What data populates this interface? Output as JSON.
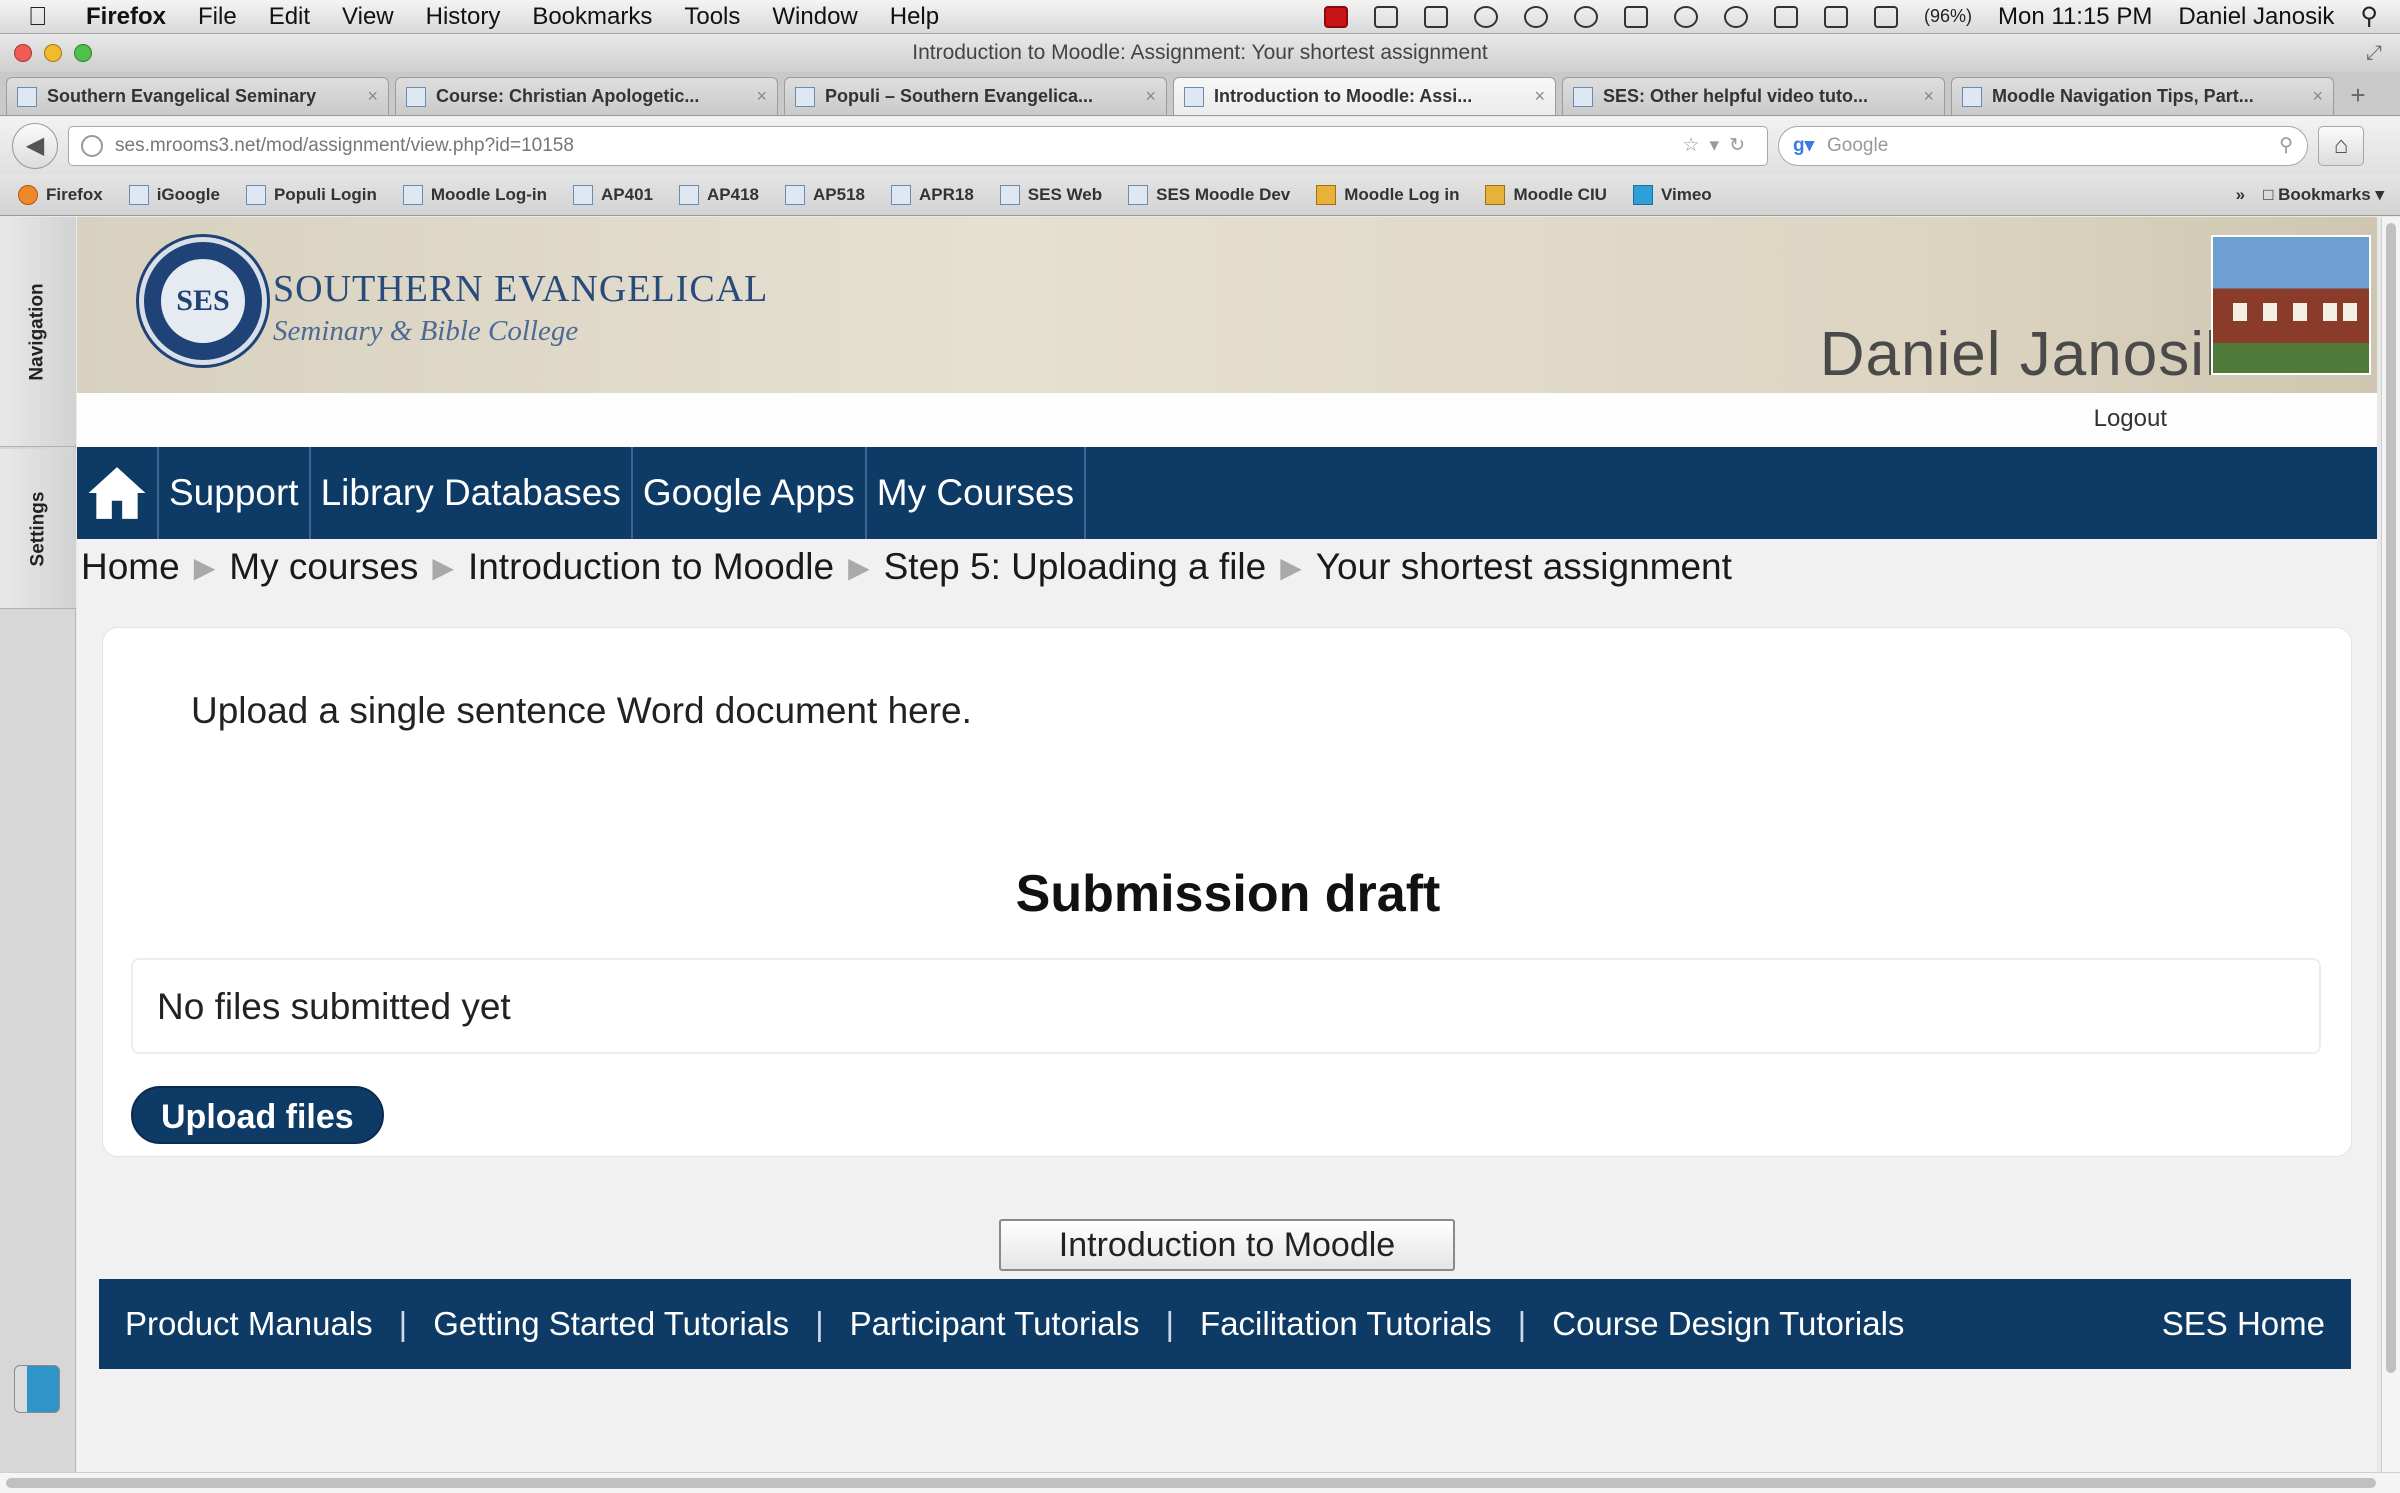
{
  "menubar": {
    "app": "Firefox",
    "items": [
      "File",
      "Edit",
      "View",
      "History",
      "Bookmarks",
      "Tools",
      "Window",
      "Help"
    ],
    "battery": "(96%)",
    "clock": "Mon 11:15 PM",
    "user": "Daniel Janosik"
  },
  "window": {
    "title": "Introduction to Moodle: Assignment: Your shortest assignment"
  },
  "tabs": [
    {
      "label": "Southern Evangelical Seminary"
    },
    {
      "label": "Course: Christian Apologetic..."
    },
    {
      "label": "Populi – Southern Evangelica..."
    },
    {
      "label": "Introduction to Moodle: Assi..."
    },
    {
      "label": "SES: Other helpful video tuto..."
    },
    {
      "label": "Moodle Navigation Tips, Part..."
    }
  ],
  "navbar": {
    "url": "ses.mrooms3.net/mod/assignment/view.php?id=10158",
    "search_placeholder": "Google"
  },
  "bookmarks": {
    "items": [
      "Firefox",
      "iGoogle",
      "Populi Login",
      "Moodle Log-in",
      "AP401",
      "AP418",
      "AP518",
      "APR18",
      "SES Web",
      "SES Moodle Dev",
      "Moodle Log in",
      "Moodle CIU",
      "Vimeo"
    ],
    "overflow": "»",
    "bookmarks_menu": "Bookmarks"
  },
  "sidebar": {
    "navigation": "Navigation",
    "settings": "Settings"
  },
  "banner": {
    "school_line1": "SOUTHERN EVANGELICAL",
    "school_line2": "Seminary & Bible College",
    "seal_text": "SES",
    "user_display": "Daniel Janosik",
    "logout": "Logout"
  },
  "mainnav": {
    "items": [
      "Support",
      "Library Databases",
      "Google Apps",
      "My Courses"
    ]
  },
  "breadcrumb": [
    "Home",
    "My courses",
    "Introduction to Moodle",
    "Step 5: Uploading a file",
    "Your shortest assignment"
  ],
  "assignment": {
    "intro": "Upload a single sentence Word document here.",
    "heading": "Submission draft",
    "files_status": "No files submitted yet",
    "upload_button": "Upload files"
  },
  "course_button": "Introduction to Moodle",
  "footer": {
    "links": [
      "Product Manuals",
      "Getting Started Tutorials",
      "Participant Tutorials",
      "Facilitation Tutorials",
      "Course Design Tutorials"
    ],
    "home": "SES Home",
    "separator": "|"
  },
  "colors": {
    "brand_navy": "#0e3a66"
  }
}
